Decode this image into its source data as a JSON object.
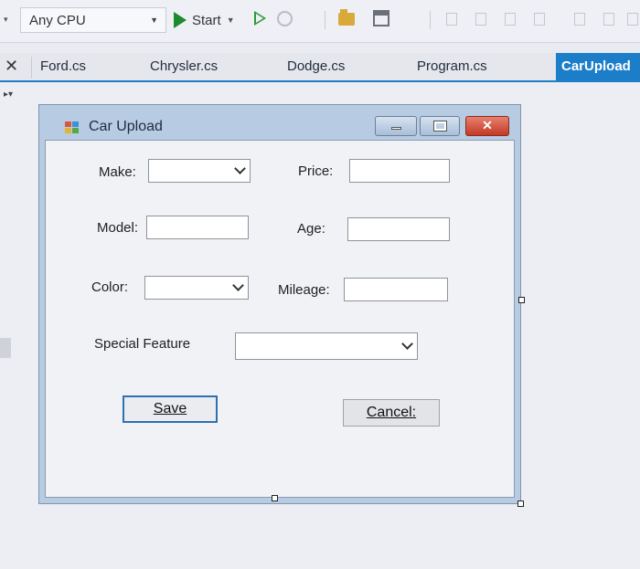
{
  "toolbar": {
    "configuration": "Any CPU",
    "start_label": "Start"
  },
  "tabs": [
    {
      "label": "Ford.cs"
    },
    {
      "label": "Chrysler.cs"
    },
    {
      "label": "Dodge.cs"
    },
    {
      "label": "Program.cs"
    },
    {
      "label": "CarUpload",
      "active": true
    }
  ],
  "form": {
    "title": "Car Upload",
    "fields": {
      "make_label": "Make:",
      "price_label": "Price:",
      "model_label": "Model:",
      "age_label": "Age:",
      "color_label": "Color:",
      "mileage_label": "Mileage:",
      "special_feature_label": "Special Feature",
      "make_value": "",
      "price_value": "",
      "model_value": "",
      "age_value": "",
      "color_value": "",
      "mileage_value": "",
      "special_feature_value": ""
    },
    "buttons": {
      "save_label": "Save",
      "cancel_label": "Cancel:"
    }
  },
  "colors": {
    "accent": "#1c7ec9",
    "close_button": "#c13a25",
    "start_green": "#1d8a2d"
  },
  "icons": [
    "play-icon",
    "play-outline-icon",
    "refresh-icon",
    "folder-icon",
    "window-icon",
    "close-icon",
    "minimize-icon",
    "maximize-icon",
    "chevron-down-icon",
    "form-icon"
  ]
}
